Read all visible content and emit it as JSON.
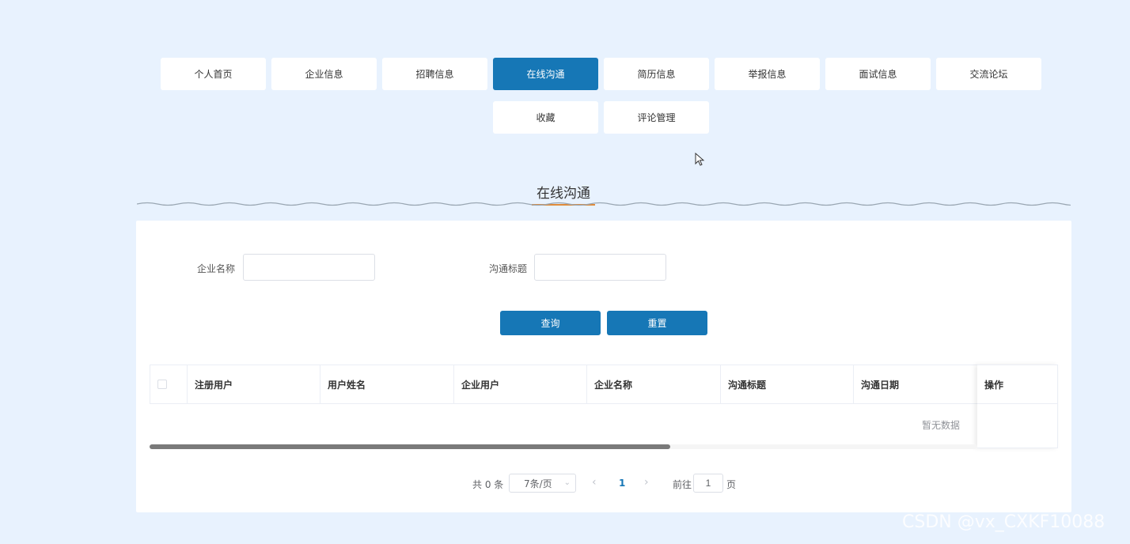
{
  "nav": {
    "items": [
      {
        "label": "个人首页"
      },
      {
        "label": "企业信息"
      },
      {
        "label": "招聘信息"
      },
      {
        "label": "在线沟通",
        "active": true
      },
      {
        "label": "简历信息"
      },
      {
        "label": "举报信息"
      },
      {
        "label": "面试信息"
      },
      {
        "label": "交流论坛"
      },
      {
        "label": "收藏"
      },
      {
        "label": "评论管理"
      }
    ]
  },
  "page_title": "在线沟通",
  "search": {
    "company_label": "企业名称",
    "company_value": "",
    "title_label": "沟通标题",
    "title_value": "",
    "query_label": "查询",
    "reset_label": "重置"
  },
  "table": {
    "columns": [
      "注册用户",
      "用户姓名",
      "企业用户",
      "企业名称",
      "沟通标题",
      "沟通日期"
    ],
    "action_column": "操作",
    "empty_text": "暂无数据",
    "rows": []
  },
  "pagination": {
    "total_text": "共 0 条",
    "page_size": "7条/页",
    "current_page": "1",
    "goto_label": "前往",
    "goto_value": "1",
    "page_suffix": "页"
  },
  "watermark": "CSDN @vx_CXKF10088",
  "colors": {
    "primary": "#1677b6",
    "background": "#e8f2fe",
    "title_underline": "#e08b3a"
  }
}
